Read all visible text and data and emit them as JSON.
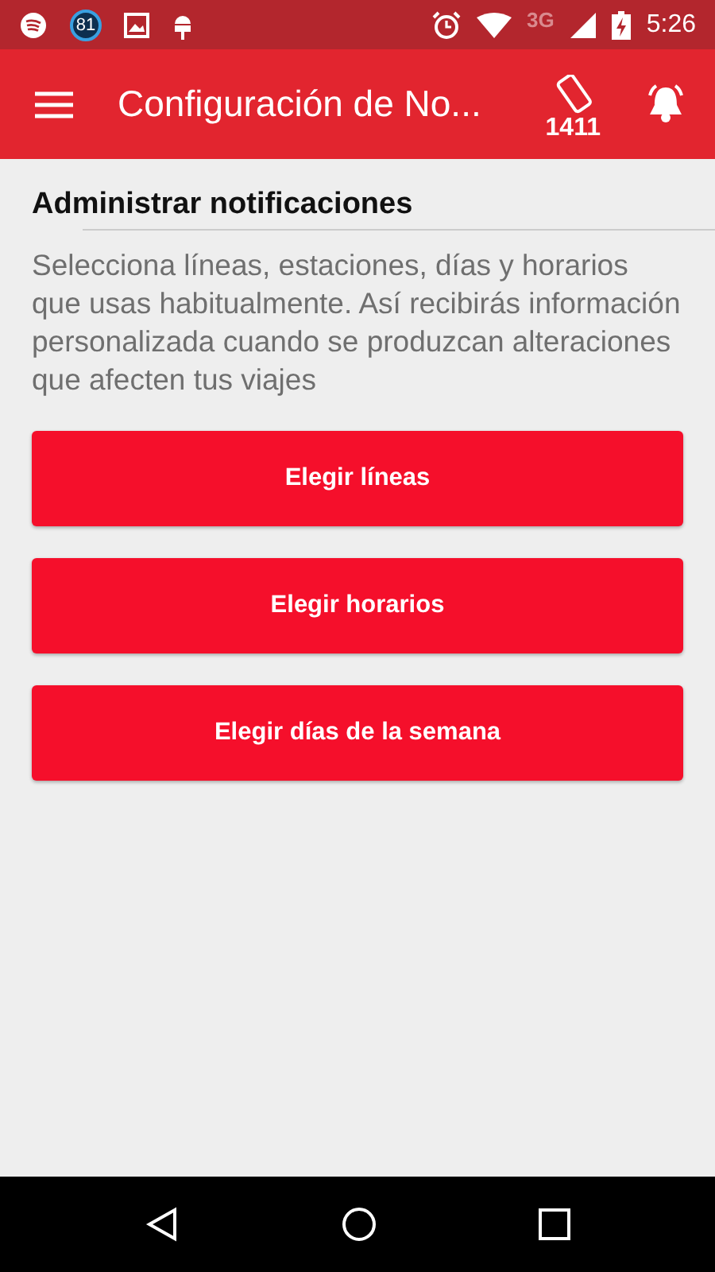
{
  "status_bar": {
    "badge": "81",
    "network": "3G",
    "time": "5:26"
  },
  "app_bar": {
    "title": "Configuración de No...",
    "phone_number": "1411"
  },
  "section": {
    "title": "Administrar notificaciones",
    "description": "Selecciona líneas, estaciones, días y horarios que usas habitualmente. Así recibirás información personalizada cuando se produzcan alteraciones que afecten tus viajes"
  },
  "buttons": [
    "Elegir líneas",
    "Elegir horarios",
    "Elegir días de la semana"
  ]
}
